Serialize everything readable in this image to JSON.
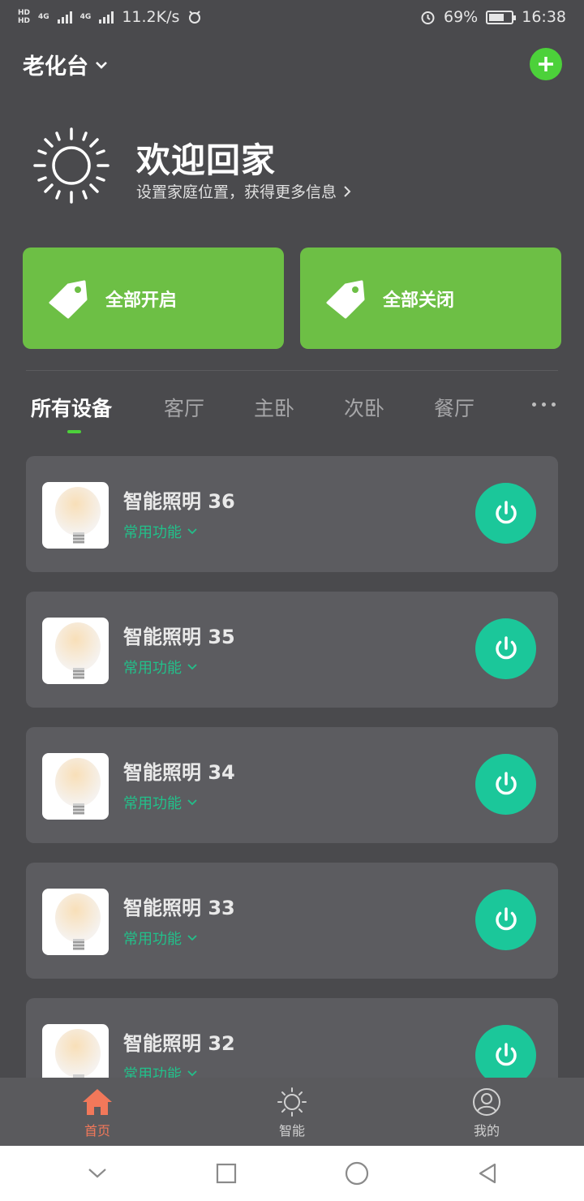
{
  "status_bar": {
    "network_speed": "11.2K/s",
    "battery": "69%",
    "battery_level": 0.69,
    "time": "16:38",
    "hd1": "HD",
    "hd2": "HD",
    "net1": "4G",
    "net2": "4G"
  },
  "header": {
    "home_name": "老化台"
  },
  "welcome": {
    "title": "欢迎回家",
    "subtitle": "设置家庭位置，获得更多信息"
  },
  "scenes": {
    "all_on": "全部开启",
    "all_off": "全部关闭"
  },
  "tabs": [
    "所有设备",
    "客厅",
    "主卧",
    "次卧",
    "餐厅"
  ],
  "devices": [
    {
      "name": "智能照明 36",
      "func": "常用功能"
    },
    {
      "name": "智能照明 35",
      "func": "常用功能"
    },
    {
      "name": "智能照明 34",
      "func": "常用功能"
    },
    {
      "name": "智能照明 33",
      "func": "常用功能"
    },
    {
      "name": "智能照明 32",
      "func": "常用功能"
    }
  ],
  "bottom_nav": {
    "home": "首页",
    "smart": "智能",
    "mine": "我的"
  },
  "colors": {
    "accent_green": "#4cd13a",
    "scene_green": "#6dbf45",
    "power_teal": "#1bc79a",
    "nav_active": "#f1785a"
  }
}
